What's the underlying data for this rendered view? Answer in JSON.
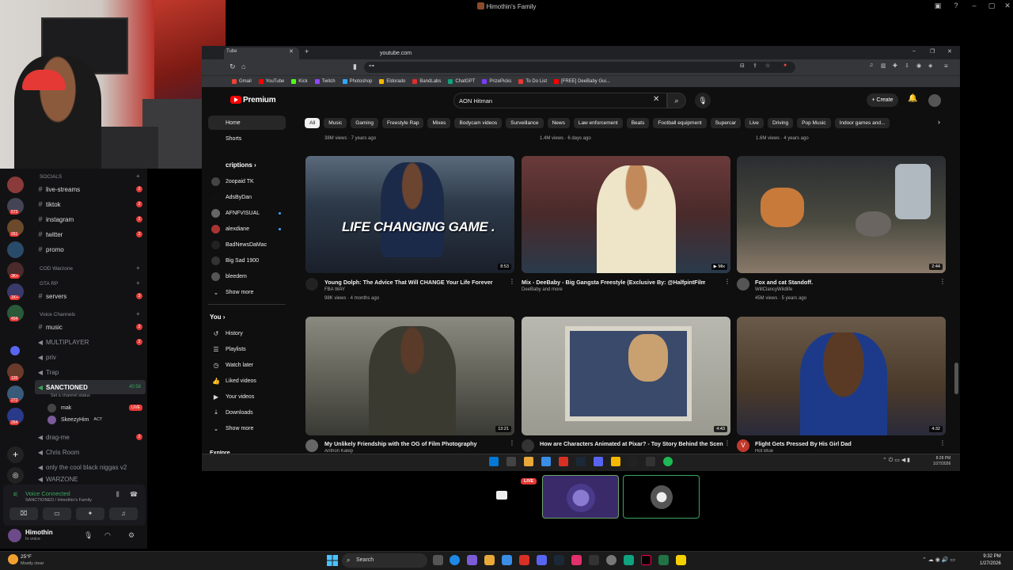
{
  "discord": {
    "window_title": "Himothin's Family",
    "categories": {
      "socials": "SOCIALS",
      "cod": "COD Warzone",
      "gta": "GTA RP",
      "voice": "Voice Channels"
    },
    "text_channels": [
      {
        "name": "live-streams",
        "badge": "2"
      },
      {
        "name": "tiktok",
        "badge": "2"
      },
      {
        "name": "instagram",
        "badge": "2"
      },
      {
        "name": "twitter",
        "badge": "2"
      },
      {
        "name": "promo",
        "badge": ""
      }
    ],
    "gta_channel": {
      "name": "servers",
      "badge": "3"
    },
    "music_channel": {
      "name": "music",
      "badge": "2"
    },
    "voice_channels": [
      {
        "name": "MULTIPLAYER",
        "badge": "2"
      },
      {
        "name": "priv",
        "badge": ""
      },
      {
        "name": "Trap",
        "badge": ""
      }
    ],
    "active_voice": {
      "name": "SANCTIONED",
      "timer": "40:58",
      "status": "Set a channel status"
    },
    "members": [
      {
        "name": "mak",
        "live": "LIVE"
      },
      {
        "name": "SkeezyHim",
        "tag": "ACT"
      }
    ],
    "more_voice": [
      {
        "name": "drag-me",
        "badge": "2"
      },
      {
        "name": "Chris Room",
        "badge": ""
      },
      {
        "name": "only the cool black niggas v2",
        "badge": ""
      },
      {
        "name": "WARZONE",
        "badge": ""
      }
    ],
    "server_badges": [
      "573",
      "261",
      "3K+",
      "1K+",
      "404",
      "120",
      "272",
      "264"
    ],
    "voice_connected": "Voice Connected",
    "voice_sub": "SANCTIONED / Himothin's Family",
    "user": {
      "name": "Himothin",
      "status": "In voice"
    }
  },
  "browser": {
    "tab_title": "Tube",
    "url": "youtube.com",
    "bookmarks": [
      "Gmail",
      "YouTube",
      "Kick",
      "Twitch",
      "Photoshop",
      "Eldorado",
      "BandLabs",
      "ChatGPT",
      "PrizePicks",
      "To Do List",
      "[FREE] DeeBaby Gui..."
    ]
  },
  "youtube": {
    "brand": "Premium",
    "search_query": "AON Hitman",
    "create_label": "Create",
    "sidebar": {
      "home": "Home",
      "shorts": "Shorts",
      "subscriptions_header": "Subscriptions",
      "subs_visible": "criptions",
      "subscriptions": [
        "2oopaid TK",
        "AdsByDan",
        "AFNFVISUAL",
        "alexdiane",
        "BadNewsDaMac",
        "Big Sad 1900",
        "bleedem"
      ],
      "show_more": "Show more",
      "you_header": "You",
      "you_items": [
        "History",
        "Playlists",
        "Watch later",
        "Liked videos",
        "Your videos",
        "Downloads"
      ],
      "show_more_2": "Show more",
      "explore": "Explore"
    },
    "chips": [
      "All",
      "Music",
      "Gaming",
      "Freestyle Rap",
      "Mixes",
      "Bodycam videos",
      "Surveillance",
      "News",
      "Law enforcement",
      "Beats",
      "Football equipment",
      "Supercar",
      "Live",
      "Driving",
      "Pop Music",
      "Indoor games and..."
    ],
    "prev_row_meta": [
      "38M views · 7 years ago",
      "1.4M views · 6 days ago",
      "1.6M views · 4 years ago"
    ],
    "videos": [
      {
        "title": "Young Dolph: The Advice That Will CHANGE Your Life Forever",
        "channel": "FBA WAY",
        "stats": "98K views · 4 months ago",
        "duration": "8:53",
        "overlay": "LIFE CHANGING GAME ."
      },
      {
        "title": "Mix - DeeBaby - Big Gangsta Freestyle (Exclusive By: @HalfpintFilmz)",
        "channel": "DeeBaby and more",
        "stats": "",
        "duration": "Mix"
      },
      {
        "title": "Fox and cat Standoff.",
        "channel": "WillClancyWildlife",
        "stats": "45M views · 5 years ago",
        "duration": "2:44"
      },
      {
        "title": "My Unlikely Friendship with the OG of Film Photography",
        "channel": "Anthon Kalep",
        "stats": "",
        "duration": "13:21"
      },
      {
        "title": "How are Characters Animated at Pixar? - Toy Story Behind the Scenes",
        "channel": "",
        "stats": "",
        "duration": "4:43"
      },
      {
        "title": "Flight Gets Pressed By His Girl Dad",
        "channel": "Hot Blue",
        "stats": "",
        "duration": "4:32"
      }
    ]
  },
  "inner_clock": {
    "time": "8:28 PM",
    "date": "1/27/2026"
  },
  "stream_tiles": {
    "live": "LIVE"
  },
  "windows": {
    "weather_temp": "25°F",
    "weather_desc": "Mostly clear",
    "search": "Search",
    "time": "9:32 PM",
    "date": "1/27/2026"
  },
  "colors": {
    "accent_red": "#e53935",
    "voice_green": "#3ba55d",
    "yt_red": "#ff0000"
  }
}
